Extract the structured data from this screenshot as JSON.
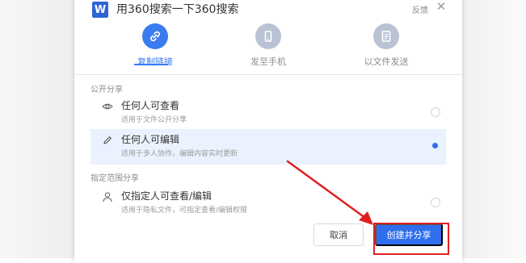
{
  "dialog": {
    "app_logo": "W",
    "title": "用360搜索一下360搜索",
    "feedback_label": "反馈",
    "close_glyph": "✕"
  },
  "tabs": [
    {
      "label": "复制链接",
      "icon": "link-icon",
      "active": true
    },
    {
      "label": "发至手机",
      "icon": "phone-icon",
      "active": false
    },
    {
      "label": "以文件发送",
      "icon": "file-icon",
      "active": false
    }
  ],
  "public_share": {
    "section_label": "公开分享",
    "options": [
      {
        "title": "任何人可查看",
        "desc": "适用于文件公开分享",
        "icon": "eye-icon",
        "selected": false
      },
      {
        "title": "任何人可编辑",
        "desc": "适用于多人协作，编辑内容实时更新",
        "icon": "pencil-icon",
        "selected": true
      }
    ]
  },
  "restricted_share": {
    "section_label": "指定范围分享",
    "options": [
      {
        "title": "仅指定人可查看/编辑",
        "desc": "适用于隐私文件，可指定查看/编辑权限",
        "icon": "user-icon",
        "selected": false
      }
    ]
  },
  "footer": {
    "cancel_label": "取消",
    "create_label": "创建并分享"
  },
  "colors": {
    "accent": "#3a7bf0",
    "primary_button": "#2f6fed",
    "selected_row": "#eaf2ff",
    "annotation": "#e02020"
  }
}
